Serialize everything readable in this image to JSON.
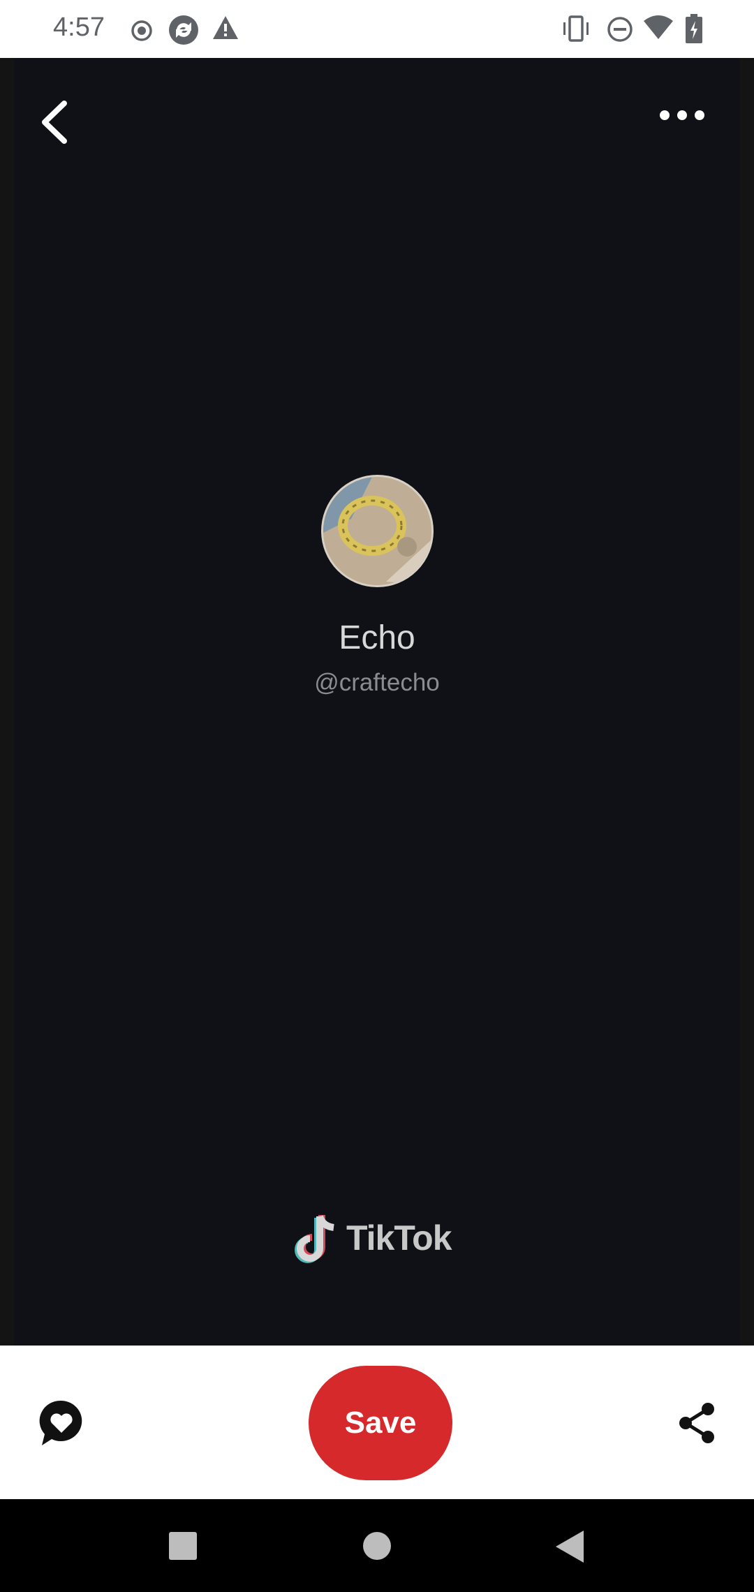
{
  "status_bar": {
    "time": "4:57",
    "left_icons": [
      "record-icon",
      "sync-icon",
      "warning-icon"
    ],
    "right_icons": [
      "vibrate-icon",
      "do-not-disturb-icon",
      "wifi-icon",
      "battery-charging-icon"
    ]
  },
  "top_bar": {
    "back_icon": "chevron-left-icon",
    "more_icon": "more-horizontal-icon"
  },
  "profile": {
    "name": "Echo",
    "handle": "@craftecho"
  },
  "watermark": {
    "brand": "TikTok"
  },
  "actions": {
    "comment_icon": "comment-heart-icon",
    "save_label": "Save",
    "share_icon": "share-icon"
  },
  "colors": {
    "accent": "#d6292c",
    "background": "#0f1116"
  },
  "nav_bar": {
    "icons": [
      "recents-icon",
      "home-icon",
      "back-icon"
    ]
  }
}
